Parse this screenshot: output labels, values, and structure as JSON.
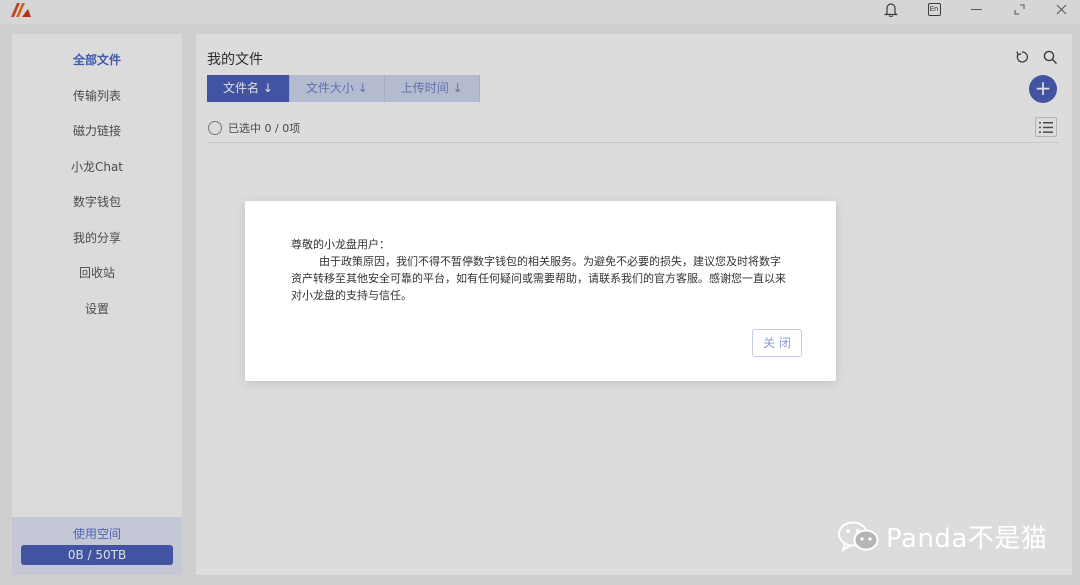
{
  "titlebar": {
    "icons": [
      "app-logo",
      "bell-icon",
      "language-en-icon",
      "minimize-icon",
      "maximize-icon",
      "close-icon"
    ],
    "lang_label": "En"
  },
  "sidebar": {
    "items": [
      {
        "label": "全部文件",
        "active": true
      },
      {
        "label": "传输列表",
        "active": false
      },
      {
        "label": "磁力链接",
        "active": false
      },
      {
        "label": "小龙Chat",
        "active": false
      },
      {
        "label": "数字钱包",
        "active": false
      },
      {
        "label": "我的分享",
        "active": false
      },
      {
        "label": "回收站",
        "active": false
      },
      {
        "label": "设置",
        "active": false
      }
    ],
    "storage": {
      "label": "使用空间",
      "value": "0B / 50TB"
    }
  },
  "main": {
    "title": "我的文件",
    "sort_tabs": [
      {
        "label": "文件名 ↓",
        "active": true
      },
      {
        "label": "文件大小 ↓",
        "active": false
      },
      {
        "label": "上传时间 ↓",
        "active": false
      }
    ],
    "selection": "已选中 0 / 0项",
    "icons": [
      "refresh-icon",
      "search-icon",
      "add-icon",
      "list-view-icon"
    ]
  },
  "dialog": {
    "greeting": "尊敬的小龙盘用户：",
    "body": "由于政策原因，我们不得不暂停数字钱包的相关服务。为避免不必要的损失，建议您及时将数字资产转移至其他安全可靠的平台，如有任何疑问或需要帮助，请联系我们的官方客服。感谢您一直以来对小龙盘的支持与信任。",
    "close_label": "关 闭"
  },
  "watermark": {
    "text": "Panda不是猫",
    "icon": "wechat-icon"
  },
  "colors": {
    "accent": "#4a5fb8",
    "accent_light": "#cfd5ec",
    "active_nav": "#4a66c8"
  }
}
